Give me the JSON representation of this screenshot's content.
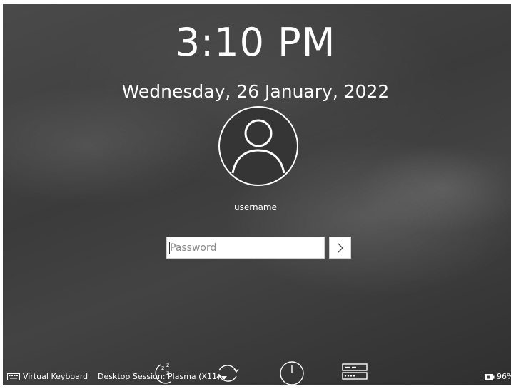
{
  "clock": {
    "time": "3:10 PM",
    "date": "Wednesday, 26 January, 2022"
  },
  "user": {
    "name": "username",
    "avatar_icon": "user-avatar-icon"
  },
  "login": {
    "password_placeholder": "Password",
    "submit_icon": "chevron-right-icon"
  },
  "bottom_bar": {
    "virtual_keyboard_label": "Virtual Keyboard",
    "virtual_keyboard_icon": "keyboard-icon",
    "session_label": "Desktop Session: Plasma (X11)",
    "session_icon": "chevron-down-icon",
    "actions": [
      {
        "name": "suspend",
        "icon": "sleep-icon"
      },
      {
        "name": "restart",
        "icon": "restart-icon"
      },
      {
        "name": "shutdown",
        "icon": "power-icon"
      },
      {
        "name": "different-user",
        "icon": "switch-user-icon"
      }
    ],
    "battery_icon": "battery-icon",
    "battery_level": "96%"
  },
  "colors": {
    "text": "#ffffff",
    "background": "#3f3f3f",
    "input_background": "#ffffff"
  }
}
